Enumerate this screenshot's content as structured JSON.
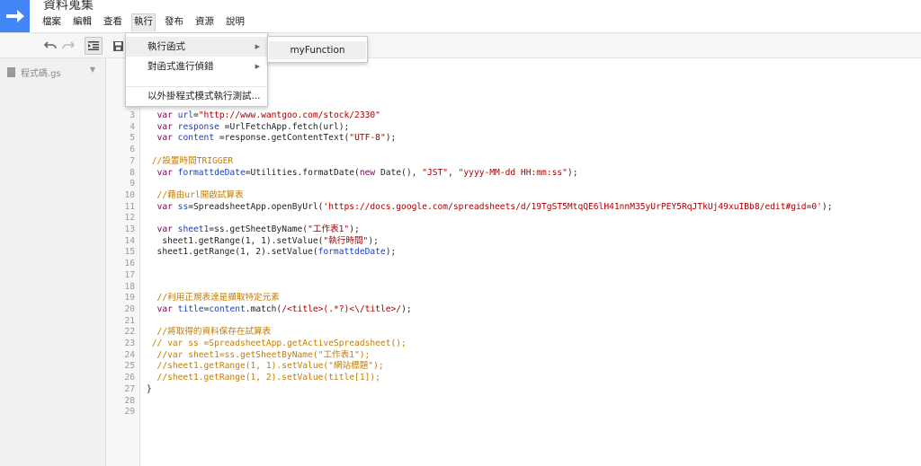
{
  "document": {
    "title": "資料蒐集"
  },
  "menubar": {
    "items": [
      {
        "label": "檔案"
      },
      {
        "label": "編輯"
      },
      {
        "label": "查看"
      },
      {
        "label": "執行"
      },
      {
        "label": "發布"
      },
      {
        "label": "資源"
      },
      {
        "label": "說明"
      }
    ]
  },
  "toolbar": {
    "undo_icon": "undo-icon",
    "redo_icon": "redo-icon",
    "indent_icon": "indent-icon",
    "save_icon": "save-icon"
  },
  "sidebar": {
    "file_name": "程式碼.gs"
  },
  "run_menu": {
    "items": [
      {
        "label": "執行函式",
        "has_submenu": true
      },
      {
        "label": "對函式進行偵錯",
        "has_submenu": true
      },
      {
        "label": "以外掛程式模式執行測試..."
      }
    ],
    "submenu_arrow": "▶"
  },
  "submenu": {
    "items": [
      {
        "label": "myFunction"
      }
    ]
  },
  "code": {
    "lines": [
      {
        "n": "3",
        "tokens": [
          {
            "t": "  "
          },
          {
            "t": "var ",
            "c": "kw"
          },
          {
            "t": "url",
            "c": "fn"
          },
          {
            "t": "="
          },
          {
            "t": "\"http://www.wantgoo.com/stock/2330\"",
            "c": "str"
          }
        ]
      },
      {
        "n": "4",
        "tokens": [
          {
            "t": "  "
          },
          {
            "t": "var ",
            "c": "kw"
          },
          {
            "t": "response",
            "c": "fn"
          },
          {
            "t": " =UrlFetchApp.fetch(url);"
          }
        ]
      },
      {
        "n": "5",
        "tokens": [
          {
            "t": "  "
          },
          {
            "t": "var ",
            "c": "kw"
          },
          {
            "t": "content",
            "c": "fn"
          },
          {
            "t": " =response.getContentText("
          },
          {
            "t": "\"UTF-8\"",
            "c": "str"
          },
          {
            "t": ");"
          }
        ]
      },
      {
        "n": "6",
        "tokens": []
      },
      {
        "n": "7",
        "tokens": [
          {
            "t": " //設置時間TRIGGER",
            "c": "cm"
          }
        ]
      },
      {
        "n": "8",
        "tokens": [
          {
            "t": "  "
          },
          {
            "t": "var ",
            "c": "kw"
          },
          {
            "t": "formattdeDate",
            "c": "fn"
          },
          {
            "t": "=Utilities.formatDate("
          },
          {
            "t": "new ",
            "c": "kw"
          },
          {
            "t": "Date(), "
          },
          {
            "t": "\"JST\"",
            "c": "str"
          },
          {
            "t": ", "
          },
          {
            "t": "\"yyyy-MM-dd HH:mm:ss\"",
            "c": "str"
          },
          {
            "t": ");"
          }
        ]
      },
      {
        "n": "9",
        "tokens": []
      },
      {
        "n": "10",
        "tokens": [
          {
            "t": "  //藉由url開啟試算表",
            "c": "cm"
          }
        ]
      },
      {
        "n": "11",
        "tokens": [
          {
            "t": "  "
          },
          {
            "t": "var ",
            "c": "kw"
          },
          {
            "t": "ss",
            "c": "fn"
          },
          {
            "t": "=SpreadsheetApp.openByUrl("
          },
          {
            "t": "'https://docs.google.com/spreadsheets/d/19TgST5MtqQE6lH41nnM35yUrPEY5RqJTkUj49xuIBb8/edit#gid=0'",
            "c": "str"
          },
          {
            "t": ");"
          }
        ]
      },
      {
        "n": "12",
        "tokens": []
      },
      {
        "n": "13",
        "tokens": [
          {
            "t": "  "
          },
          {
            "t": "var ",
            "c": "kw"
          },
          {
            "t": "sheet1",
            "c": "fn"
          },
          {
            "t": "=ss.getSheetByName("
          },
          {
            "t": "\"工作表1\"",
            "c": "str"
          },
          {
            "t": ");"
          }
        ]
      },
      {
        "n": "14",
        "tokens": [
          {
            "t": "   sheet1.getRange(1, 1).setValue("
          },
          {
            "t": "\"執行時間\"",
            "c": "str"
          },
          {
            "t": ");"
          }
        ]
      },
      {
        "n": "15",
        "tokens": [
          {
            "t": "  sheet1.getRange(1, 2).setValue("
          },
          {
            "t": "formattdeDate",
            "c": "fn"
          },
          {
            "t": ");"
          }
        ]
      },
      {
        "n": "16",
        "tokens": []
      },
      {
        "n": "17",
        "tokens": []
      },
      {
        "n": "18",
        "tokens": []
      },
      {
        "n": "19",
        "tokens": [
          {
            "t": "  //利用正規表達是擷取特定元素",
            "c": "cm"
          }
        ]
      },
      {
        "n": "20",
        "tokens": [
          {
            "t": "  "
          },
          {
            "t": "var ",
            "c": "kw"
          },
          {
            "t": "title",
            "c": "fn"
          },
          {
            "t": "="
          },
          {
            "t": "content",
            "c": "fn"
          },
          {
            "t": ".match("
          },
          {
            "t": "/<title>(.*?)<\\/title>/",
            "c": "str"
          },
          {
            "t": ");"
          }
        ]
      },
      {
        "n": "21",
        "tokens": []
      },
      {
        "n": "22",
        "tokens": [
          {
            "t": "  //將取得的資料保存在試算表",
            "c": "cm"
          }
        ]
      },
      {
        "n": "23",
        "tokens": [
          {
            "t": " // var ss =SpreadsheetApp.getActiveSpreadsheet();",
            "c": "cm"
          }
        ]
      },
      {
        "n": "24",
        "tokens": [
          {
            "t": "  //var sheet1=ss.getSheetByName(\"工作表1\");",
            "c": "cm"
          }
        ]
      },
      {
        "n": "25",
        "tokens": [
          {
            "t": "  //sheet1.getRange(1, 1).setValue(\"網站標題\");",
            "c": "cm"
          }
        ]
      },
      {
        "n": "26",
        "tokens": [
          {
            "t": "  //sheet1.getRange(1, 2).setValue(title[1]);",
            "c": "cm"
          }
        ]
      },
      {
        "n": "27",
        "tokens": [
          {
            "t": "}"
          }
        ]
      },
      {
        "n": "28",
        "tokens": []
      },
      {
        "n": "29",
        "tokens": []
      }
    ]
  }
}
